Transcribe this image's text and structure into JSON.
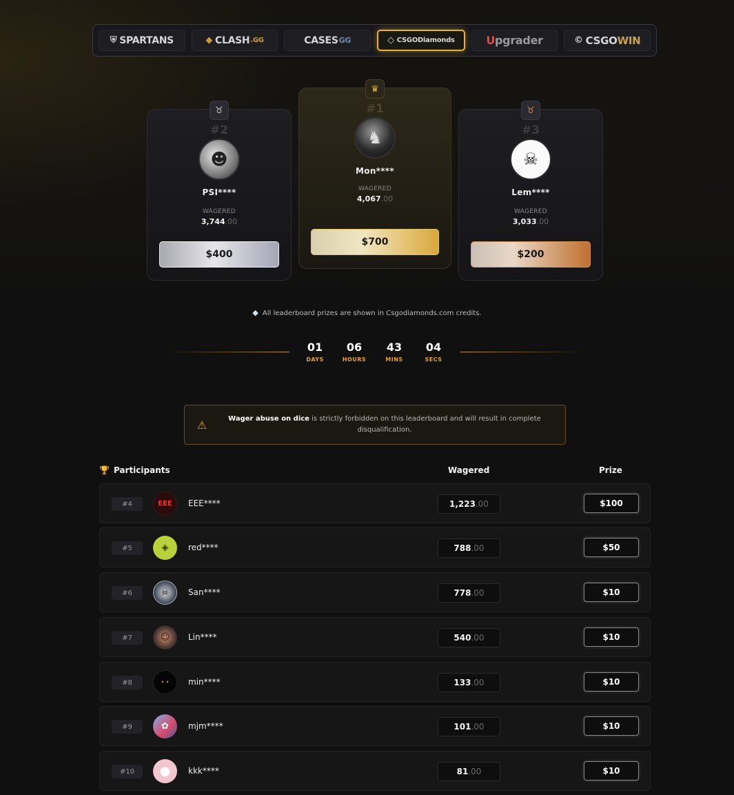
{
  "site_tabs": [
    {
      "label": "SPARTANS",
      "icon": "spartan-helmet-icon"
    },
    {
      "label": "CLASH",
      "suffix": ".GG",
      "icon": "clash-diamond-icon"
    },
    {
      "label": "CASES",
      "suffix": "GG"
    },
    {
      "label": "CSGODiamonds",
      "icon": "diamonds-logo-icon",
      "active": true
    },
    {
      "prefix": "U",
      "label": "pgrader"
    },
    {
      "label": "CSGO",
      "suffix": "WIN",
      "icon": "csgowin-c-icon"
    }
  ],
  "podium": {
    "first": {
      "rank": "#1",
      "name": "Mon****",
      "wagered_label": "WAGERED",
      "wagered": "4,067",
      "wagered_dec": ".00",
      "prize": "$700",
      "badge_icon": "crown-icon"
    },
    "second": {
      "rank": "#2",
      "name": "PSI****",
      "wagered_label": "WAGERED",
      "wagered": "3,744",
      "wagered_dec": ".00",
      "prize": "$400",
      "badge_icon": "silver-medal-icon"
    },
    "third": {
      "rank": "#3",
      "name": "Lem****",
      "wagered_label": "WAGERED",
      "wagered": "3,033",
      "wagered_dec": ".00",
      "prize": "$200",
      "badge_icon": "bronze-medal-icon"
    }
  },
  "note": "All leaderboard prizes are shown in Csgodiamonds.com credits.",
  "countdown": {
    "days": "01",
    "days_label": "DAYS",
    "hours": "06",
    "hours_label": "HOURS",
    "mins": "43",
    "mins_label": "MINS",
    "secs": "04",
    "secs_label": "SECS"
  },
  "warning": {
    "bold": "Wager abuse on dice",
    "text": " is strictly forbidden on this leaderboard and will result in complete disqualification."
  },
  "table": {
    "participants_label": "Participants",
    "wagered_label": "Wagered",
    "prize_label": "Prize",
    "rows": [
      {
        "rank": "#4",
        "name": "EEE****",
        "wagered": "1,223",
        "dec": ".00",
        "prize": "$100",
        "avatar_color": "#2a0a0a"
      },
      {
        "rank": "#5",
        "name": "red****",
        "wagered": "788",
        "dec": ".00",
        "prize": "$50",
        "avatar_color": "#b9d23a"
      },
      {
        "rank": "#6",
        "name": "San****",
        "wagered": "778",
        "dec": ".00",
        "prize": "$10",
        "avatar_color": "#4e5a6a"
      },
      {
        "rank": "#7",
        "name": "Lin****",
        "wagered": "540",
        "dec": ".00",
        "prize": "$10",
        "avatar_color": "#6a4a3a"
      },
      {
        "rank": "#8",
        "name": "min****",
        "wagered": "133",
        "dec": ".00",
        "prize": "$10",
        "avatar_color": "#0a0a0a"
      },
      {
        "rank": "#9",
        "name": "mjm****",
        "wagered": "101",
        "dec": ".00",
        "prize": "$10",
        "avatar_color": "#3a5ea8"
      },
      {
        "rank": "#10",
        "name": "kkk****",
        "wagered": "81",
        "dec": ".00",
        "prize": "$10",
        "avatar_color": "#f3c6cf"
      }
    ]
  }
}
